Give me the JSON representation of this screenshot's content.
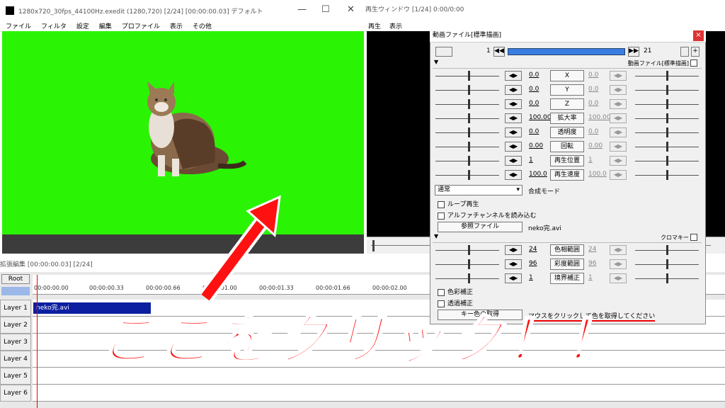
{
  "main": {
    "title": "1280x720_30fps_44100Hz.exedit (1280,720)  [2/24]  [00:00:00.03]  デフォルト",
    "menu": [
      "ファイル",
      "フィルタ",
      "設定",
      "編集",
      "プロファイル",
      "表示",
      "その他"
    ]
  },
  "play": {
    "title": "再生ウィンドウ  [1/24]  0:00/0:00",
    "menu": [
      "再生",
      "表示"
    ]
  },
  "timeline": {
    "title": "拡張編集 [00:00:00.03] [2/24]",
    "root": "Root",
    "ticks": [
      "00:00:00.00",
      "00:00:00.33",
      "00:00:00.66",
      "00:00:01.00",
      "00:00:01.33",
      "00:00:01.66",
      "00:00:02.00"
    ],
    "layers": [
      "Layer 1",
      "Layer 2",
      "Layer 3",
      "Layer 4",
      "Layer 5",
      "Layer 6"
    ],
    "clip": "neko完.avi"
  },
  "dialog": {
    "title": "動画ファイル[標準描画]",
    "frame_start": "1",
    "frame_end": "21",
    "section1": "動画ファイル[標準描画]",
    "params": [
      {
        "label": "X",
        "value": "0.0",
        "value2": "0.0"
      },
      {
        "label": "Y",
        "value": "0.0",
        "value2": "0.0"
      },
      {
        "label": "Z",
        "value": "0.0",
        "value2": "0.0"
      },
      {
        "label": "拡大率",
        "value": "100.00",
        "value2": "100.00"
      },
      {
        "label": "透明度",
        "value": "0.0",
        "value2": "0.0"
      },
      {
        "label": "回転",
        "value": "0.00",
        "value2": "0.00"
      },
      {
        "label": "再生位置",
        "value": "1",
        "value2": "1"
      },
      {
        "label": "再生速度",
        "value": "100.0",
        "value2": "100.0"
      }
    ],
    "blend_value": "通常",
    "blend_label": "合成モード",
    "loop_label": "ループ再生",
    "alpha_label": "アルファチャンネルを読み込む",
    "ref_button": "参照ファイル",
    "ref_file": "neko完.avi",
    "section2": "クロマキー",
    "chroma": [
      {
        "label": "色相範囲",
        "value": "24",
        "value2": "24"
      },
      {
        "label": "彩度範囲",
        "value": "96",
        "value2": "96"
      },
      {
        "label": "境界補正",
        "value": "1",
        "value2": "1"
      }
    ],
    "color_correct": "色彩補正",
    "transparent_correct": "透過補正",
    "key_button": "キー色の取得",
    "key_hint": "マウスをクリックして色を取得してください"
  },
  "annotation": "ここをクリック！！",
  "colors": {
    "preview_bg": "#2af403",
    "annotation": "#ff1111",
    "clip": "#0c1fa0"
  }
}
